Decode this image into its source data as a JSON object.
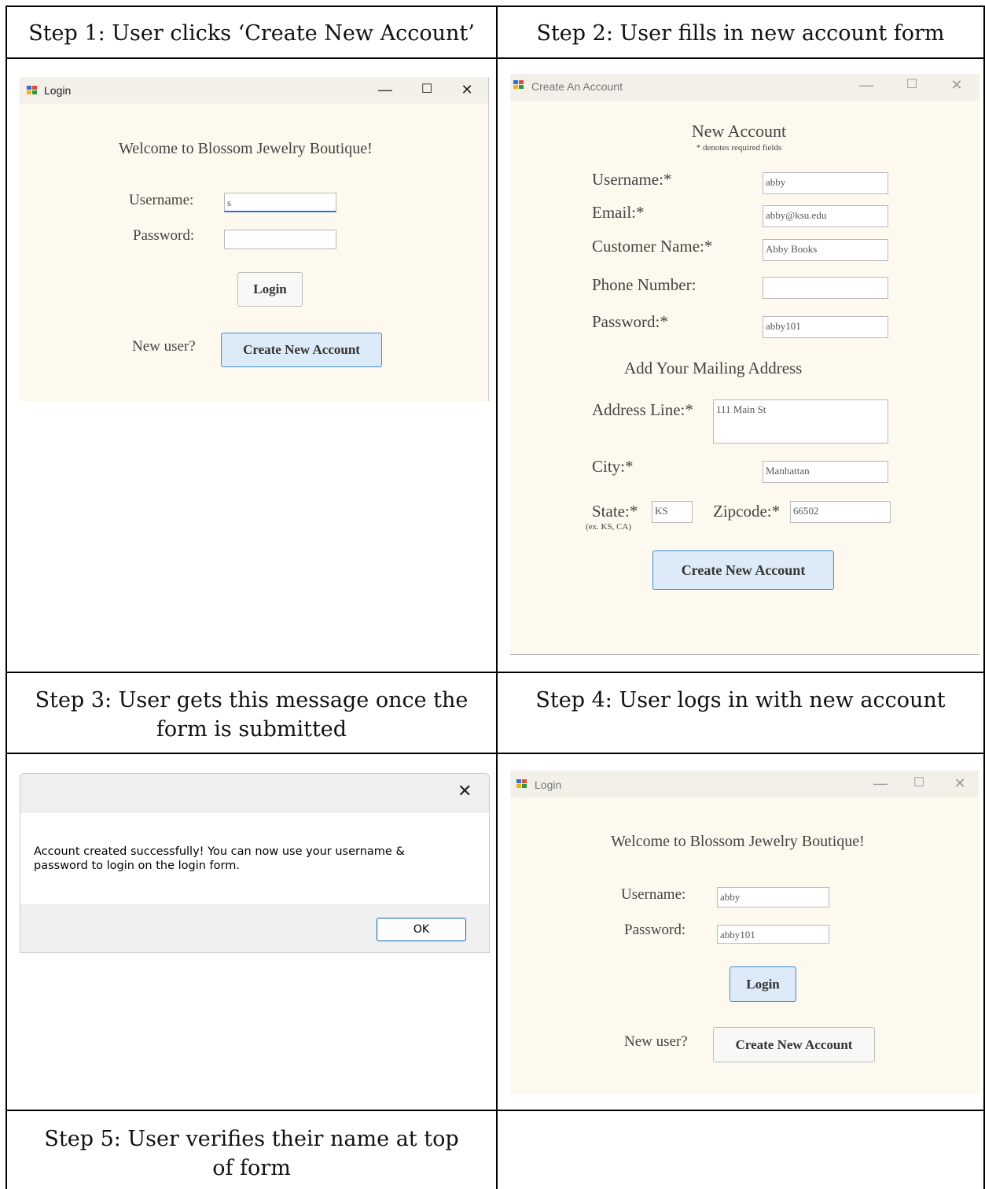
{
  "steps": {
    "s1": "Step 1: User clicks ‘Create New Account’",
    "s2": "Step 2: User fills in new account form",
    "s3": "Step 3: User gets this message once the form is submitted",
    "s4": "Step 4: User logs in with new account",
    "s5": "Step 5: User verifies their name at top of form"
  },
  "login1": {
    "window_title": "Login",
    "welcome": "Welcome to Blossom Jewelry Boutique!",
    "username_label": "Username:",
    "username_value": "s",
    "password_label": "Password:",
    "password_value": "",
    "login_button": "Login",
    "new_user_label": "New user?",
    "create_button": "Create New Account"
  },
  "create_form": {
    "window_title": "Create An Account",
    "heading": "New Account",
    "required_note": "* denotes required fields",
    "username_label": "Username:*",
    "username_value": "abby",
    "email_label": "Email:*",
    "email_value": "abby@ksu.edu",
    "customer_label": "Customer Name:*",
    "customer_value": "Abby Books",
    "phone_label": "Phone Number:",
    "phone_value": "",
    "password_label": "Password:*",
    "password_value": "abby101",
    "mailing_heading": "Add Your Mailing Address",
    "address_label": "Address Line:*",
    "address_value": "111 Main St",
    "city_label": "City:*",
    "city_value": "Manhattan",
    "state_label": "State:*",
    "state_hint": "(ex. KS, CA)",
    "state_value": "KS",
    "zip_label": "Zipcode:*",
    "zip_value": "66502",
    "create_button": "Create New Account"
  },
  "message_box": {
    "text": "Account created successfully! You can now use your username & password to login on the login form.",
    "ok_button": "OK",
    "close_glyph": "✕"
  },
  "login2": {
    "window_title": "Login",
    "welcome": "Welcome to Blossom Jewelry Boutique!",
    "username_label": "Username:",
    "username_value": "abby",
    "password_label": "Password:",
    "password_value": "abby101",
    "login_button": "Login",
    "new_user_label": "New user?",
    "create_button": "Create New Account"
  },
  "window_controls": {
    "minimize": "—",
    "maximize": "☐",
    "close": "✕"
  },
  "colors": {
    "form_bg": "#fdf9ee",
    "accent_blue": "#3d8fd1",
    "button_blue_bg": "#dcebf7"
  }
}
